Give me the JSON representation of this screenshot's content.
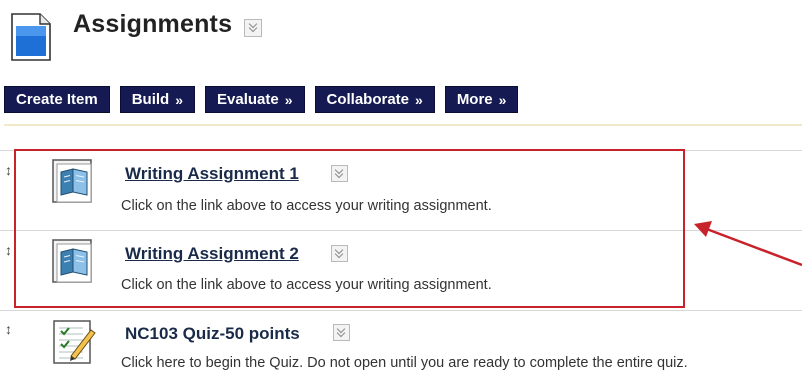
{
  "page": {
    "title": "Assignments"
  },
  "toolbar": {
    "buttons": [
      {
        "label": "Create Item",
        "has_menu": false
      },
      {
        "label": "Build",
        "has_menu": true
      },
      {
        "label": "Evaluate",
        "has_menu": true
      },
      {
        "label": "Collaborate",
        "has_menu": true
      },
      {
        "label": "More",
        "has_menu": true
      }
    ]
  },
  "items": [
    {
      "title": "Writing Assignment 1",
      "description": "Click on the link above to access your writing assignment.",
      "icon": "assignment-icon"
    },
    {
      "title": "Writing Assignment 2",
      "description": "Click on the link above to access your writing assignment.",
      "icon": "assignment-icon"
    },
    {
      "title": "NC103 Quiz-50 points",
      "description": "Click here to begin the Quiz. Do not open until you are ready to complete the entire quiz.",
      "icon": "quiz-icon"
    }
  ],
  "colors": {
    "toolbar_bg": "#151a52",
    "highlight": "#c8232b",
    "link": "#1a2b4a"
  }
}
